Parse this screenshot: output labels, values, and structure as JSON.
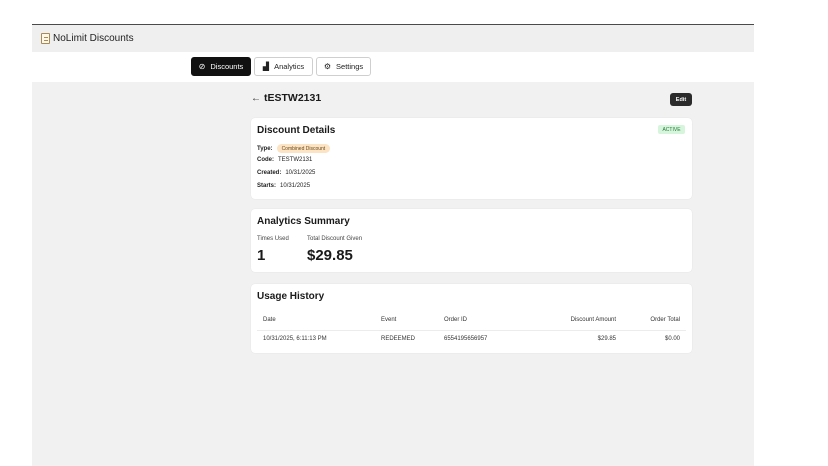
{
  "app": {
    "title": "NoLimit Discounts",
    "icon": "document-icon"
  },
  "nav": {
    "tabs": [
      {
        "label": "Discounts",
        "icon": "discount-icon",
        "active": true
      },
      {
        "label": "Analytics",
        "icon": "bar-chart-icon",
        "active": false
      },
      {
        "label": "Settings",
        "icon": "gear-icon",
        "active": false
      }
    ]
  },
  "page": {
    "title": "tESTW2131",
    "back_symbol": "←",
    "edit_label": "Edit"
  },
  "details": {
    "title": "Discount Details",
    "status": "ACTIVE",
    "type_label": "Type:",
    "type_value": "Combined Discount",
    "code_label": "Code:",
    "code_value": "TESTW2131",
    "created_label": "Created:",
    "created_value": "10/31/2025",
    "starts_label": "Starts:",
    "starts_value": "10/31/2025"
  },
  "analytics": {
    "title": "Analytics Summary",
    "times_used_label": "Times Used",
    "times_used_value": "1",
    "total_label": "Total Discount Given",
    "total_value": "$29.85"
  },
  "usage": {
    "title": "Usage History",
    "columns": [
      "Date",
      "Event",
      "Order ID",
      "Discount Amount",
      "Order Total"
    ],
    "rows": [
      [
        "10/31/2025, 6:11:13 PM",
        "REDEEMED",
        "6554195656957",
        "$29.85",
        "$0.00"
      ]
    ]
  },
  "colors": {
    "accent": "#111111",
    "active_badge": "#d7f5dc",
    "type_chip": "#fbe3c3"
  }
}
